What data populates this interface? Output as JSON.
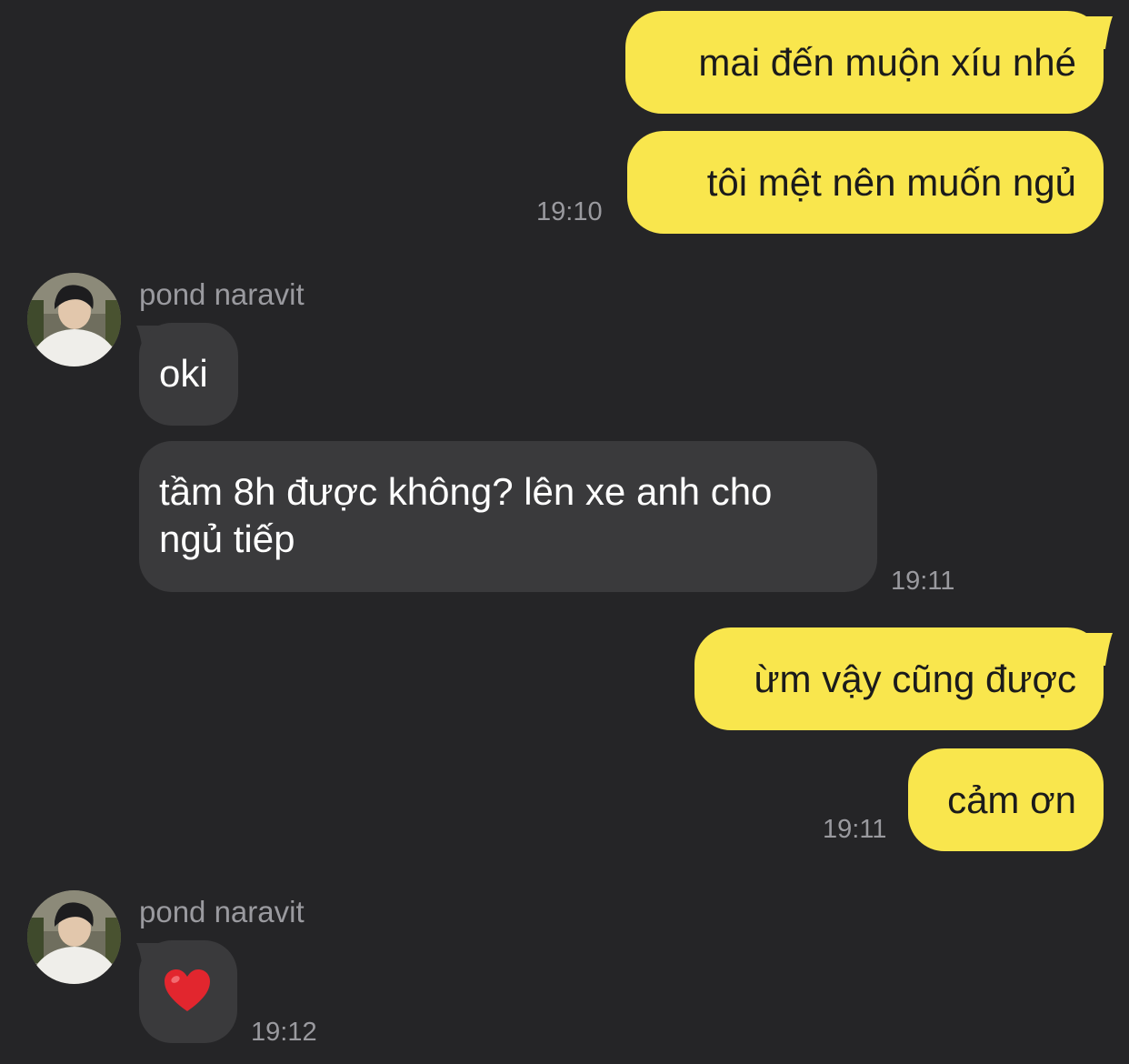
{
  "contact": {
    "name": "pond naravit"
  },
  "messages": {
    "m1": "mai đến muộn xíu nhé",
    "m2": "tôi mệt nên muốn ngủ",
    "m3": "oki",
    "m4_line1": "tầm 8h được không? lên xe anh cho",
    "m4_line2": "ngủ tiếp",
    "m5": "ừm vậy cũng được",
    "m6": "cảm ơn",
    "m7_emoji": "heart"
  },
  "times": {
    "t1": "19:10",
    "t2": "19:11",
    "t3": "19:11",
    "t4": "19:12"
  },
  "colors": {
    "background": "#252527",
    "outgoing_bubble": "#f9e64d",
    "incoming_bubble": "#3a3a3c",
    "timestamp": "#9a9a9f",
    "heart": "#e2262e"
  }
}
